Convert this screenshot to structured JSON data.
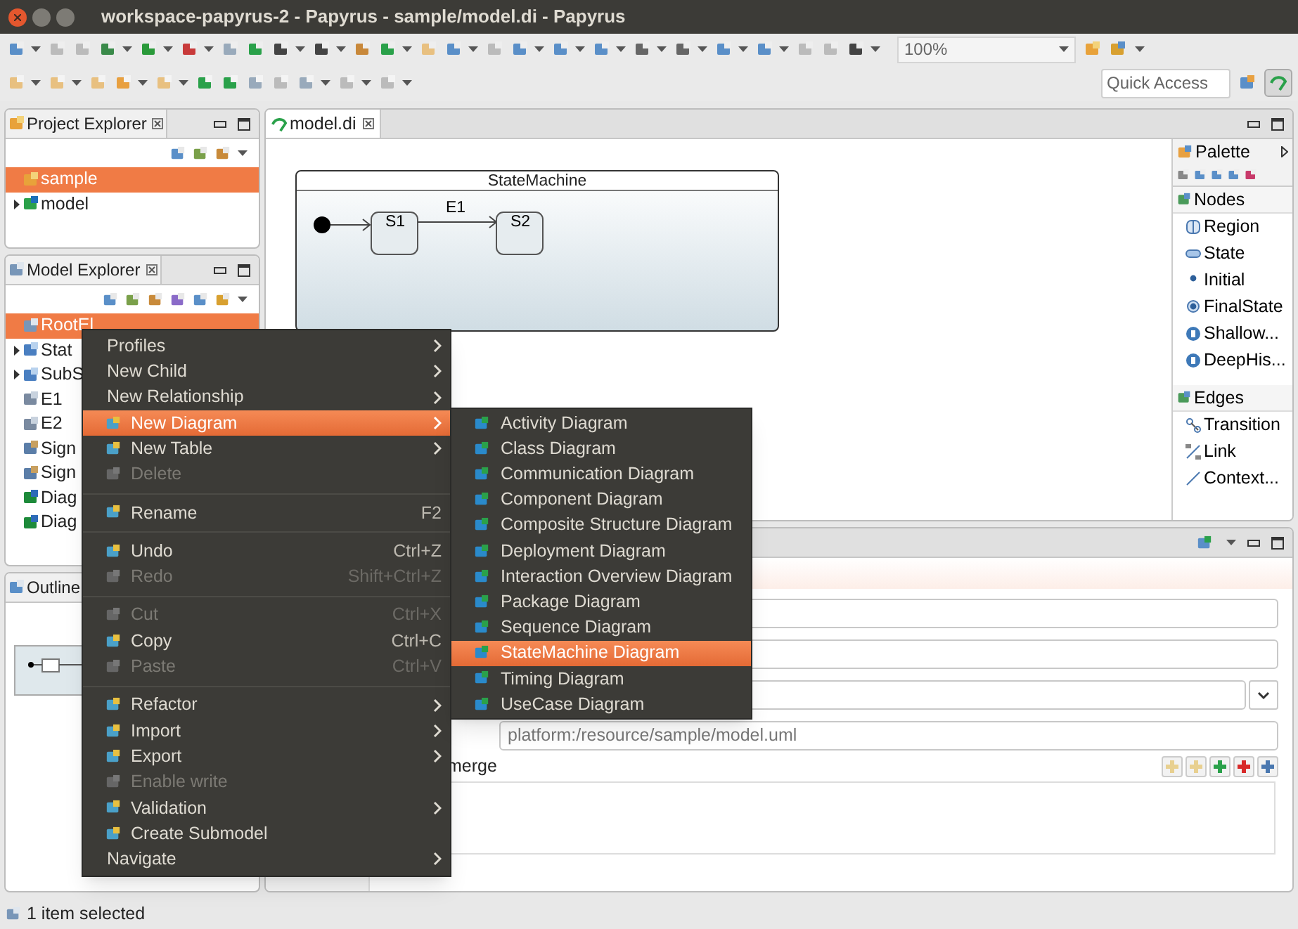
{
  "window": {
    "title": "workspace-papyrus-2 - Papyrus - sample/model.di - Papyrus"
  },
  "toolbar": {
    "zoom": "100%",
    "quick_access": {
      "placeholder": "Quick Access"
    }
  },
  "project_explorer": {
    "title": "Project Explorer",
    "items": [
      {
        "label": "sample",
        "selected": true,
        "collapsed": false,
        "kind": "project"
      },
      {
        "label": "model",
        "selected": false,
        "collapsed": true,
        "kind": "model"
      }
    ]
  },
  "model_explorer": {
    "title": "Model Explorer",
    "items": [
      {
        "label": "RootEl",
        "selected": true,
        "collapsed": false,
        "kind": "package"
      },
      {
        "label": "Stat",
        "selected": false,
        "collapsed": true,
        "kind": "statemachine"
      },
      {
        "label": "SubS",
        "selected": false,
        "collapsed": true,
        "kind": "statemachine"
      },
      {
        "label": "E1",
        "selected": false,
        "collapsed": false,
        "kind": "event"
      },
      {
        "label": "E2",
        "selected": false,
        "collapsed": false,
        "kind": "event"
      },
      {
        "label": "Sign",
        "selected": false,
        "collapsed": false,
        "kind": "signal"
      },
      {
        "label": "Sign",
        "selected": false,
        "collapsed": false,
        "kind": "signal"
      },
      {
        "label": "Diag",
        "selected": false,
        "collapsed": false,
        "kind": "diagram"
      },
      {
        "label": "Diag",
        "selected": false,
        "collapsed": false,
        "kind": "diagram"
      }
    ]
  },
  "outline": {
    "title": "Outline"
  },
  "editor": {
    "tab": "model.di",
    "diagram": {
      "title": "StateMachine",
      "states": [
        "S1",
        "S2"
      ],
      "transition": "E1"
    }
  },
  "palette": {
    "title": "Palette",
    "groups": [
      {
        "title": "Nodes",
        "items": [
          {
            "label": "Region",
            "kind": "region"
          },
          {
            "label": "State",
            "kind": "state"
          },
          {
            "label": "Initial",
            "kind": "initial"
          },
          {
            "label": "FinalState",
            "kind": "final"
          },
          {
            "label": "Shallow...",
            "kind": "history"
          },
          {
            "label": "DeepHis...",
            "kind": "history"
          }
        ]
      },
      {
        "title": "Edges",
        "items": [
          {
            "label": "Transition",
            "kind": "transition"
          },
          {
            "label": "Link",
            "kind": "link"
          },
          {
            "label": "Context...",
            "kind": "line"
          }
        ]
      }
    ]
  },
  "properties": {
    "uri": "platform:/resource/sample/model.uml",
    "list_label": "merge"
  },
  "context_menu": [
    {
      "kind": "item",
      "label": "Profiles",
      "submenu": true,
      "disabled": false,
      "selected": false
    },
    {
      "kind": "item",
      "label": "New Child",
      "submenu": true,
      "disabled": false,
      "selected": false
    },
    {
      "kind": "item",
      "label": "New Relationship",
      "submenu": true,
      "disabled": false,
      "selected": false
    },
    {
      "kind": "command",
      "label": "New Diagram",
      "submenu": true,
      "disabled": false,
      "selected": true
    },
    {
      "kind": "command",
      "label": "New Table",
      "submenu": true,
      "disabled": false,
      "selected": false
    },
    {
      "kind": "command",
      "label": "Delete",
      "submenu": false,
      "disabled": true,
      "selected": false
    },
    {
      "kind": "separator"
    },
    {
      "kind": "command",
      "label": "Rename",
      "shortcut": "F2",
      "submenu": false,
      "disabled": false,
      "selected": false
    },
    {
      "kind": "separator"
    },
    {
      "kind": "command",
      "label": "Undo",
      "shortcut": "Ctrl+Z",
      "submenu": false,
      "disabled": false,
      "selected": false
    },
    {
      "kind": "command",
      "label": "Redo",
      "shortcut": "Shift+Ctrl+Z",
      "submenu": false,
      "disabled": true,
      "selected": false
    },
    {
      "kind": "separator"
    },
    {
      "kind": "command",
      "label": "Cut",
      "shortcut": "Ctrl+X",
      "submenu": false,
      "disabled": true,
      "selected": false
    },
    {
      "kind": "command",
      "label": "Copy",
      "shortcut": "Ctrl+C",
      "submenu": false,
      "disabled": false,
      "selected": false
    },
    {
      "kind": "command",
      "label": "Paste",
      "shortcut": "Ctrl+V",
      "submenu": false,
      "disabled": true,
      "selected": false
    },
    {
      "kind": "separator"
    },
    {
      "kind": "command",
      "label": "Refactor",
      "submenu": true,
      "disabled": false,
      "selected": false
    },
    {
      "kind": "command",
      "label": "Import",
      "submenu": true,
      "disabled": false,
      "selected": false
    },
    {
      "kind": "command",
      "label": "Export",
      "submenu": true,
      "disabled": false,
      "selected": false
    },
    {
      "kind": "command",
      "label": "Enable write",
      "submenu": false,
      "disabled": true,
      "selected": false
    },
    {
      "kind": "command",
      "label": "Validation",
      "submenu": true,
      "disabled": false,
      "selected": false
    },
    {
      "kind": "command",
      "label": "Create Submodel",
      "submenu": false,
      "disabled": false,
      "selected": false
    },
    {
      "kind": "item",
      "label": "Navigate",
      "submenu": true,
      "disabled": false,
      "selected": false
    }
  ],
  "submenu": [
    {
      "label": "Activity Diagram",
      "selected": false
    },
    {
      "label": "Class Diagram",
      "selected": false
    },
    {
      "label": "Communication Diagram",
      "selected": false
    },
    {
      "label": "Component Diagram",
      "selected": false
    },
    {
      "label": "Composite Structure Diagram",
      "selected": false
    },
    {
      "label": "Deployment Diagram",
      "selected": false
    },
    {
      "label": "Interaction Overview Diagram",
      "selected": false
    },
    {
      "label": "Package Diagram",
      "selected": false
    },
    {
      "label": "Sequence Diagram",
      "selected": false
    },
    {
      "label": "StateMachine Diagram",
      "selected": true
    },
    {
      "label": "Timing Diagram",
      "selected": false
    },
    {
      "label": "UseCase Diagram",
      "selected": false
    }
  ],
  "status_bar": "1 item selected"
}
